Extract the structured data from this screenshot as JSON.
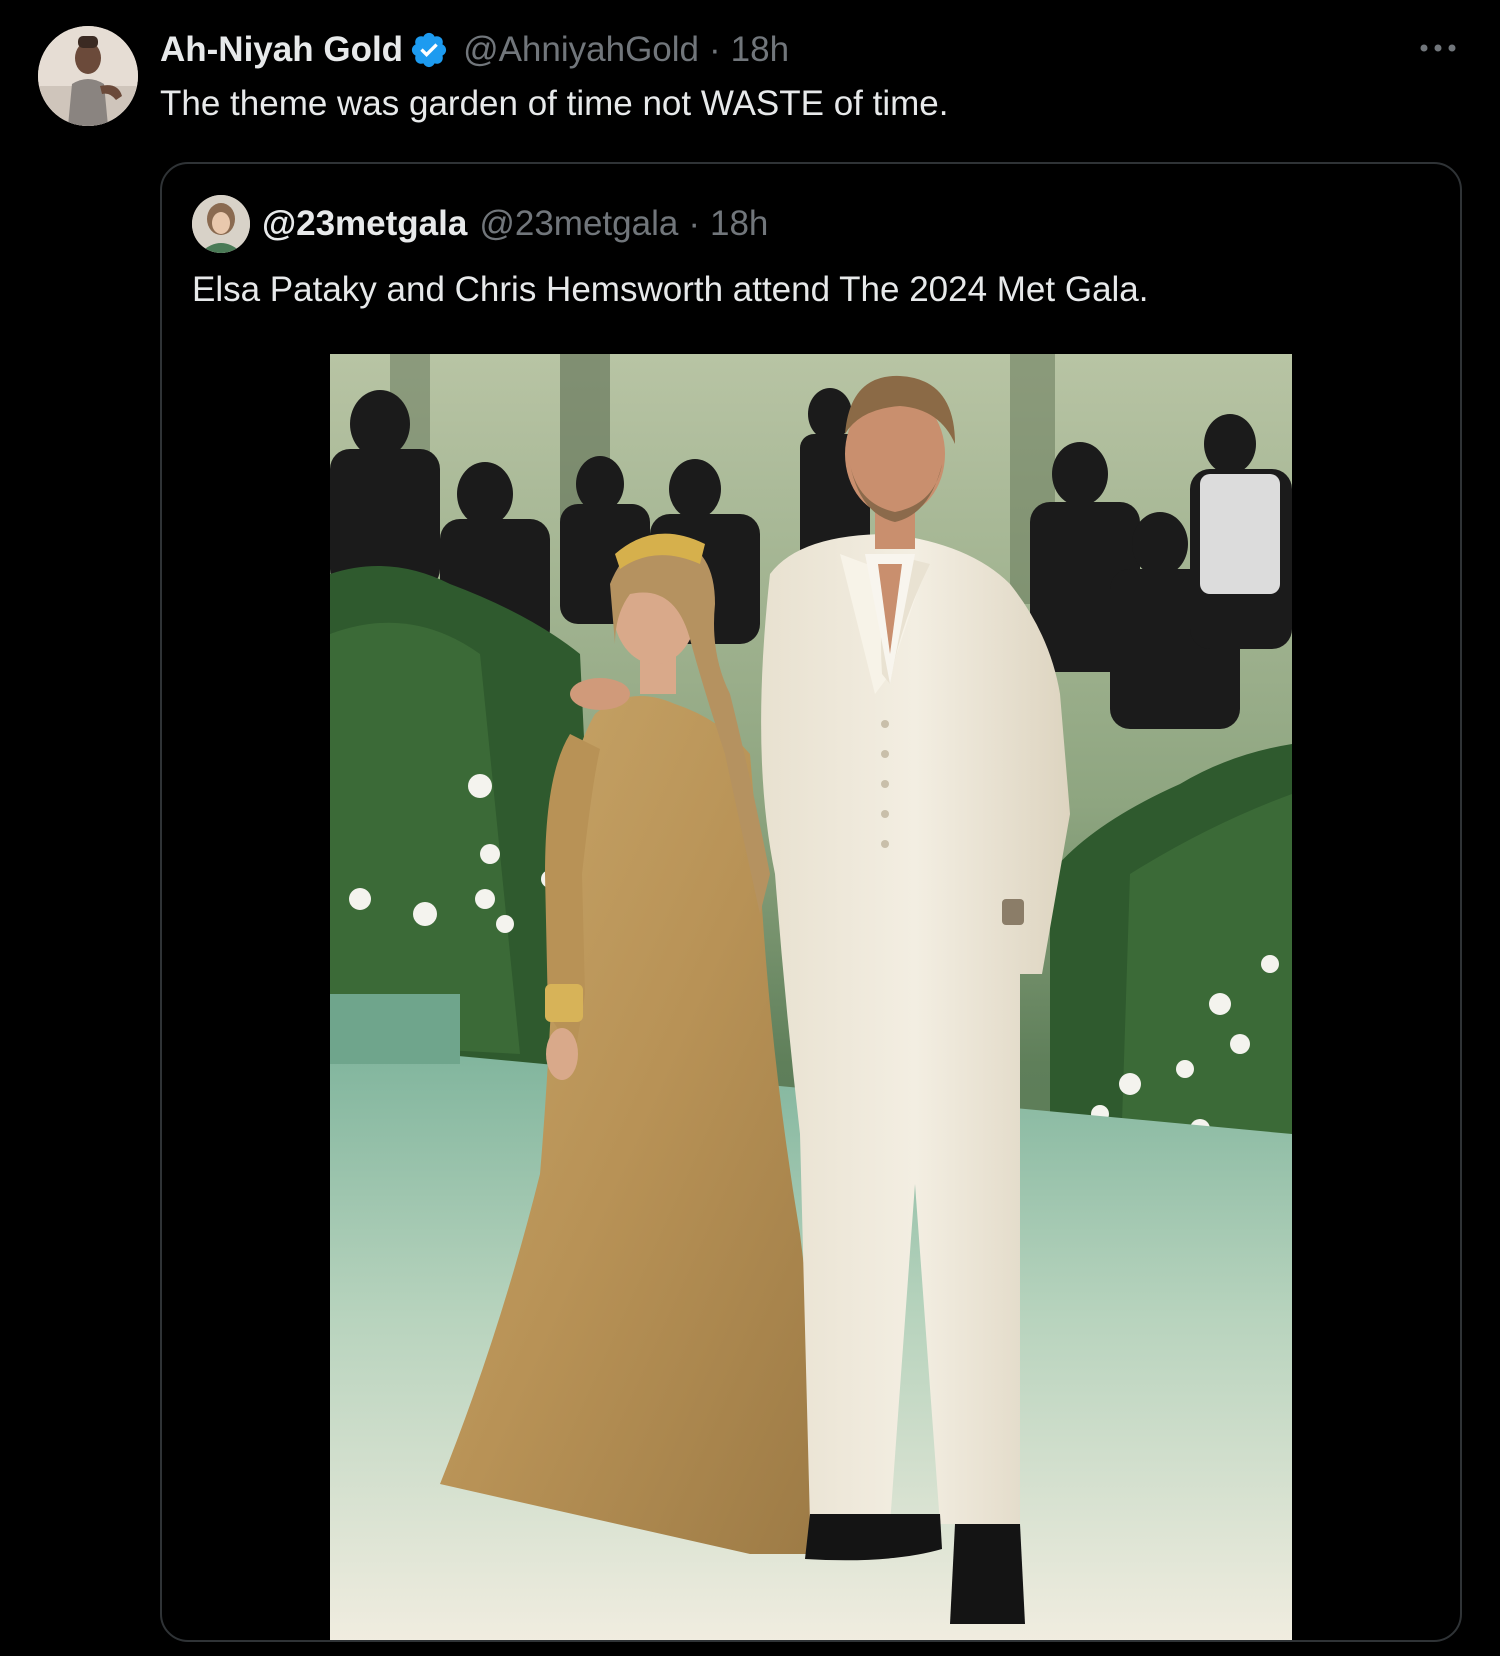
{
  "tweet": {
    "author": {
      "display_name": "Ah-Niyah Gold",
      "verified_icon": "verified-badge-icon",
      "handle": "@AhniyahGold",
      "separator": "·",
      "time": "18h"
    },
    "more_icon": "more-horizontal-icon",
    "text": "The theme was garden of time not WASTE of time."
  },
  "quote": {
    "author": {
      "display_name": "@23metgala",
      "handle": "@23metgala",
      "separator": "·",
      "time": "18h"
    },
    "text": "Elsa Pataky and Chris Hemsworth attend The 2024 Met Gala."
  },
  "colors": {
    "background": "#000000",
    "text_primary": "#e7e9ea",
    "text_secondary": "#71767b",
    "border": "#2f3336",
    "verified_blue": "#1d9bf0"
  }
}
